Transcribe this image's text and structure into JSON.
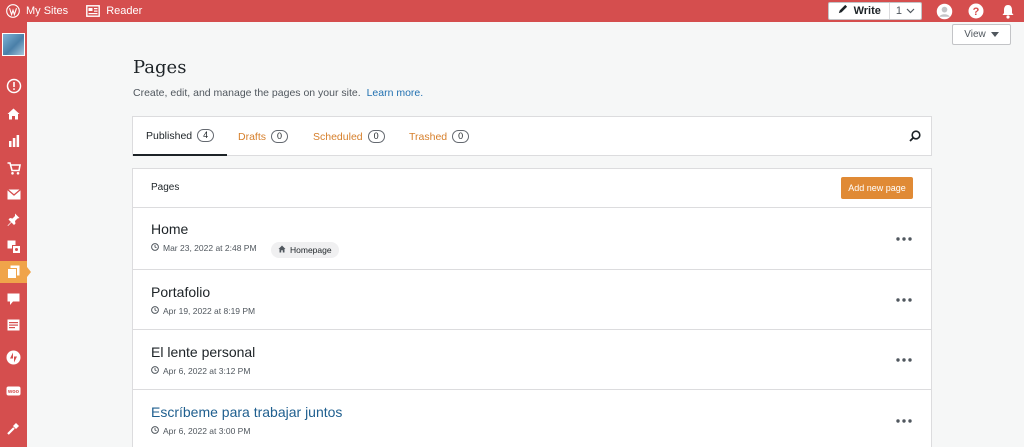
{
  "topbar": {
    "my_sites": "My Sites",
    "reader": "Reader",
    "write": "Write",
    "write_count": "1"
  },
  "view_button": "View",
  "header": {
    "title": "Pages",
    "subtitle": "Create, edit, and manage the pages on your site.",
    "learn_more": "Learn more."
  },
  "tabs": [
    {
      "label": "Published",
      "count": "4",
      "active": true
    },
    {
      "label": "Drafts",
      "count": "0",
      "active": false
    },
    {
      "label": "Scheduled",
      "count": "0",
      "active": false
    },
    {
      "label": "Trashed",
      "count": "0",
      "active": false
    }
  ],
  "list": {
    "header_label": "Pages",
    "add_button": "Add new page",
    "rows": [
      {
        "title": "Home",
        "date": "Mar 23, 2022 at 2:48 PM",
        "badge": "Homepage"
      },
      {
        "title": "Portafolio",
        "date": "Apr 19, 2022 at 8:19 PM"
      },
      {
        "title": "El lente personal",
        "date": "Apr 6, 2022 at 3:12 PM"
      },
      {
        "title": "Escríbeme para trabajar juntos",
        "date": "Apr 6, 2022 at 3:00 PM"
      }
    ]
  },
  "colors": {
    "brand_red": "#d54e4e",
    "accent_orange": "#e08a35",
    "link_blue": "#2271b1"
  },
  "icons": {
    "topbar": [
      "wordpress-logo-icon",
      "reader-icon",
      "pen-icon",
      "avatar-icon",
      "help-icon",
      "bell-icon"
    ],
    "sidebar": [
      "site-icon",
      "alert-icon",
      "home-icon",
      "stats-icon",
      "cart-icon",
      "mail-icon",
      "pin-icon",
      "media-icon",
      "pages-icon",
      "comment-icon",
      "feedback-icon",
      "jetpack-icon",
      "woo-icon",
      "tools-icon"
    ]
  }
}
